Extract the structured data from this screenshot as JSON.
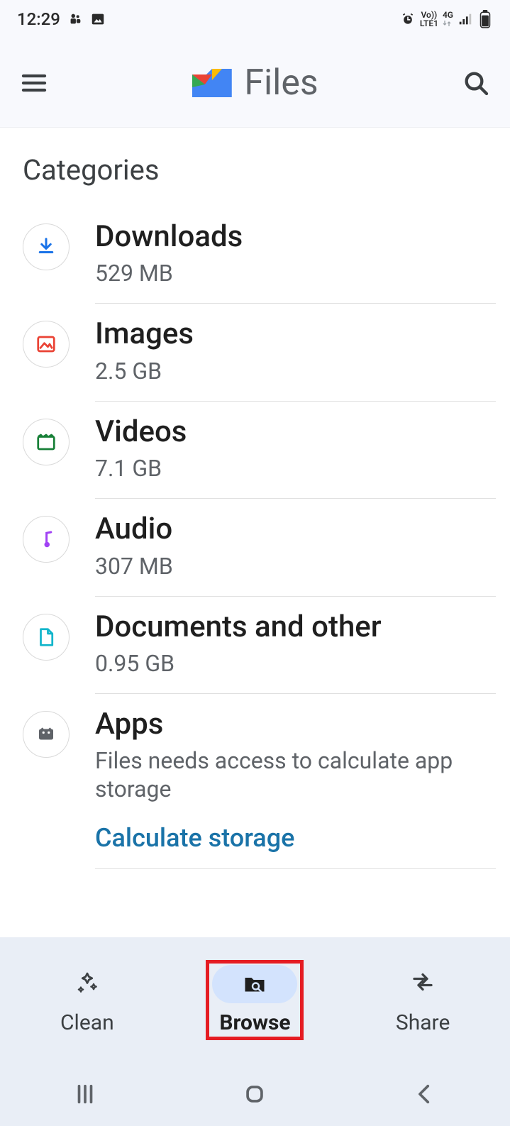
{
  "status": {
    "time": "12:29",
    "network": "LTE1",
    "net_gen": "4G",
    "volte": "Vo))"
  },
  "header": {
    "title": "Files"
  },
  "section": {
    "title": "Categories"
  },
  "categories": [
    {
      "name": "Downloads",
      "size": "529 MB"
    },
    {
      "name": "Images",
      "size": "2.5 GB"
    },
    {
      "name": "Videos",
      "size": "7.1 GB"
    },
    {
      "name": "Audio",
      "size": "307 MB"
    },
    {
      "name": "Documents and other",
      "size": "0.95 GB"
    },
    {
      "name": "Apps",
      "size": "Files needs access to calculate app storage",
      "action": "Calculate storage"
    }
  ],
  "nav": {
    "clean": "Clean",
    "browse": "Browse",
    "share": "Share"
  }
}
